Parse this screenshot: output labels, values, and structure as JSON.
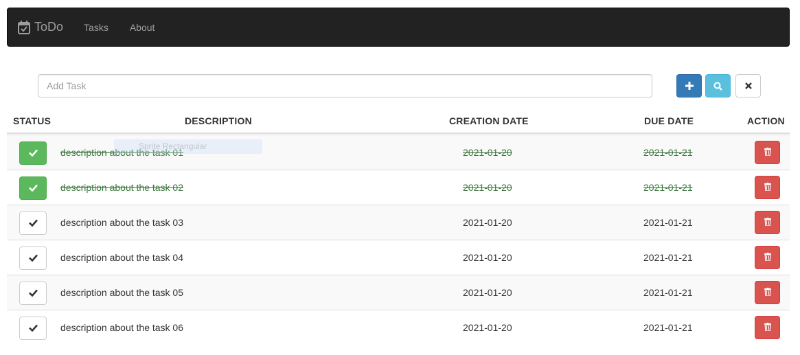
{
  "navbar": {
    "brand": "ToDo",
    "links": [
      "Tasks",
      "About"
    ]
  },
  "add_task": {
    "placeholder": "Add Task",
    "value": ""
  },
  "toolbar": {
    "add_icon": "plus-icon",
    "search_icon": "search-icon",
    "clear_icon": "close-icon"
  },
  "table": {
    "headers": {
      "status": "STATUS",
      "description": "DESCRIPTION",
      "creation_date": "CREATION DATE",
      "due_date": "DUE DATE",
      "action": "ACTION"
    },
    "rows": [
      {
        "done": true,
        "description": "description about the task 01",
        "created": "2021-01-20",
        "due": "2021-01-21"
      },
      {
        "done": true,
        "description": "description about the task 02",
        "created": "2021-01-20",
        "due": "2021-01-21"
      },
      {
        "done": false,
        "description": "description about the task 03",
        "created": "2021-01-20",
        "due": "2021-01-21"
      },
      {
        "done": false,
        "description": "description about the task 04",
        "created": "2021-01-20",
        "due": "2021-01-21"
      },
      {
        "done": false,
        "description": "description about the task 05",
        "created": "2021-01-20",
        "due": "2021-01-21"
      },
      {
        "done": false,
        "description": "description about the task 06",
        "created": "2021-01-20",
        "due": "2021-01-21"
      }
    ]
  },
  "overlay": {
    "drag_hint": "Sprite Rectangular"
  },
  "colors": {
    "navbar_bg": "#222222",
    "primary": "#337ab7",
    "info": "#5bc0de",
    "success": "#5cb85c",
    "danger": "#d9534f",
    "done_text": "#3c763d"
  }
}
